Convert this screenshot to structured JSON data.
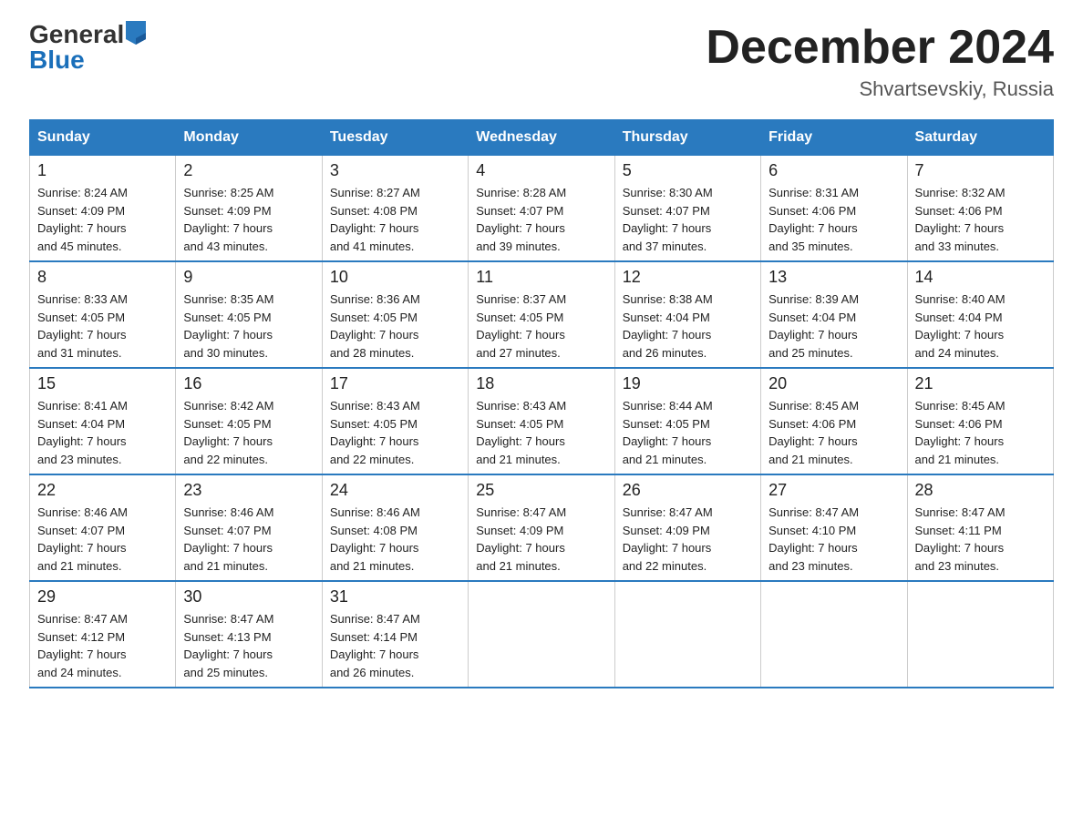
{
  "header": {
    "logo_general": "General",
    "logo_blue": "Blue",
    "title": "December 2024",
    "subtitle": "Shvartsevskiy, Russia"
  },
  "days_of_week": [
    "Sunday",
    "Monday",
    "Tuesday",
    "Wednesday",
    "Thursday",
    "Friday",
    "Saturday"
  ],
  "weeks": [
    [
      {
        "day": "1",
        "sunrise": "Sunrise: 8:24 AM",
        "sunset": "Sunset: 4:09 PM",
        "daylight": "Daylight: 7 hours and 45 minutes."
      },
      {
        "day": "2",
        "sunrise": "Sunrise: 8:25 AM",
        "sunset": "Sunset: 4:09 PM",
        "daylight": "Daylight: 7 hours and 43 minutes."
      },
      {
        "day": "3",
        "sunrise": "Sunrise: 8:27 AM",
        "sunset": "Sunset: 4:08 PM",
        "daylight": "Daylight: 7 hours and 41 minutes."
      },
      {
        "day": "4",
        "sunrise": "Sunrise: 8:28 AM",
        "sunset": "Sunset: 4:07 PM",
        "daylight": "Daylight: 7 hours and 39 minutes."
      },
      {
        "day": "5",
        "sunrise": "Sunrise: 8:30 AM",
        "sunset": "Sunset: 4:07 PM",
        "daylight": "Daylight: 7 hours and 37 minutes."
      },
      {
        "day": "6",
        "sunrise": "Sunrise: 8:31 AM",
        "sunset": "Sunset: 4:06 PM",
        "daylight": "Daylight: 7 hours and 35 minutes."
      },
      {
        "day": "7",
        "sunrise": "Sunrise: 8:32 AM",
        "sunset": "Sunset: 4:06 PM",
        "daylight": "Daylight: 7 hours and 33 minutes."
      }
    ],
    [
      {
        "day": "8",
        "sunrise": "Sunrise: 8:33 AM",
        "sunset": "Sunset: 4:05 PM",
        "daylight": "Daylight: 7 hours and 31 minutes."
      },
      {
        "day": "9",
        "sunrise": "Sunrise: 8:35 AM",
        "sunset": "Sunset: 4:05 PM",
        "daylight": "Daylight: 7 hours and 30 minutes."
      },
      {
        "day": "10",
        "sunrise": "Sunrise: 8:36 AM",
        "sunset": "Sunset: 4:05 PM",
        "daylight": "Daylight: 7 hours and 28 minutes."
      },
      {
        "day": "11",
        "sunrise": "Sunrise: 8:37 AM",
        "sunset": "Sunset: 4:05 PM",
        "daylight": "Daylight: 7 hours and 27 minutes."
      },
      {
        "day": "12",
        "sunrise": "Sunrise: 8:38 AM",
        "sunset": "Sunset: 4:04 PM",
        "daylight": "Daylight: 7 hours and 26 minutes."
      },
      {
        "day": "13",
        "sunrise": "Sunrise: 8:39 AM",
        "sunset": "Sunset: 4:04 PM",
        "daylight": "Daylight: 7 hours and 25 minutes."
      },
      {
        "day": "14",
        "sunrise": "Sunrise: 8:40 AM",
        "sunset": "Sunset: 4:04 PM",
        "daylight": "Daylight: 7 hours and 24 minutes."
      }
    ],
    [
      {
        "day": "15",
        "sunrise": "Sunrise: 8:41 AM",
        "sunset": "Sunset: 4:04 PM",
        "daylight": "Daylight: 7 hours and 23 minutes."
      },
      {
        "day": "16",
        "sunrise": "Sunrise: 8:42 AM",
        "sunset": "Sunset: 4:05 PM",
        "daylight": "Daylight: 7 hours and 22 minutes."
      },
      {
        "day": "17",
        "sunrise": "Sunrise: 8:43 AM",
        "sunset": "Sunset: 4:05 PM",
        "daylight": "Daylight: 7 hours and 22 minutes."
      },
      {
        "day": "18",
        "sunrise": "Sunrise: 8:43 AM",
        "sunset": "Sunset: 4:05 PM",
        "daylight": "Daylight: 7 hours and 21 minutes."
      },
      {
        "day": "19",
        "sunrise": "Sunrise: 8:44 AM",
        "sunset": "Sunset: 4:05 PM",
        "daylight": "Daylight: 7 hours and 21 minutes."
      },
      {
        "day": "20",
        "sunrise": "Sunrise: 8:45 AM",
        "sunset": "Sunset: 4:06 PM",
        "daylight": "Daylight: 7 hours and 21 minutes."
      },
      {
        "day": "21",
        "sunrise": "Sunrise: 8:45 AM",
        "sunset": "Sunset: 4:06 PM",
        "daylight": "Daylight: 7 hours and 21 minutes."
      }
    ],
    [
      {
        "day": "22",
        "sunrise": "Sunrise: 8:46 AM",
        "sunset": "Sunset: 4:07 PM",
        "daylight": "Daylight: 7 hours and 21 minutes."
      },
      {
        "day": "23",
        "sunrise": "Sunrise: 8:46 AM",
        "sunset": "Sunset: 4:07 PM",
        "daylight": "Daylight: 7 hours and 21 minutes."
      },
      {
        "day": "24",
        "sunrise": "Sunrise: 8:46 AM",
        "sunset": "Sunset: 4:08 PM",
        "daylight": "Daylight: 7 hours and 21 minutes."
      },
      {
        "day": "25",
        "sunrise": "Sunrise: 8:47 AM",
        "sunset": "Sunset: 4:09 PM",
        "daylight": "Daylight: 7 hours and 21 minutes."
      },
      {
        "day": "26",
        "sunrise": "Sunrise: 8:47 AM",
        "sunset": "Sunset: 4:09 PM",
        "daylight": "Daylight: 7 hours and 22 minutes."
      },
      {
        "day": "27",
        "sunrise": "Sunrise: 8:47 AM",
        "sunset": "Sunset: 4:10 PM",
        "daylight": "Daylight: 7 hours and 23 minutes."
      },
      {
        "day": "28",
        "sunrise": "Sunrise: 8:47 AM",
        "sunset": "Sunset: 4:11 PM",
        "daylight": "Daylight: 7 hours and 23 minutes."
      }
    ],
    [
      {
        "day": "29",
        "sunrise": "Sunrise: 8:47 AM",
        "sunset": "Sunset: 4:12 PM",
        "daylight": "Daylight: 7 hours and 24 minutes."
      },
      {
        "day": "30",
        "sunrise": "Sunrise: 8:47 AM",
        "sunset": "Sunset: 4:13 PM",
        "daylight": "Daylight: 7 hours and 25 minutes."
      },
      {
        "day": "31",
        "sunrise": "Sunrise: 8:47 AM",
        "sunset": "Sunset: 4:14 PM",
        "daylight": "Daylight: 7 hours and 26 minutes."
      },
      null,
      null,
      null,
      null
    ]
  ]
}
